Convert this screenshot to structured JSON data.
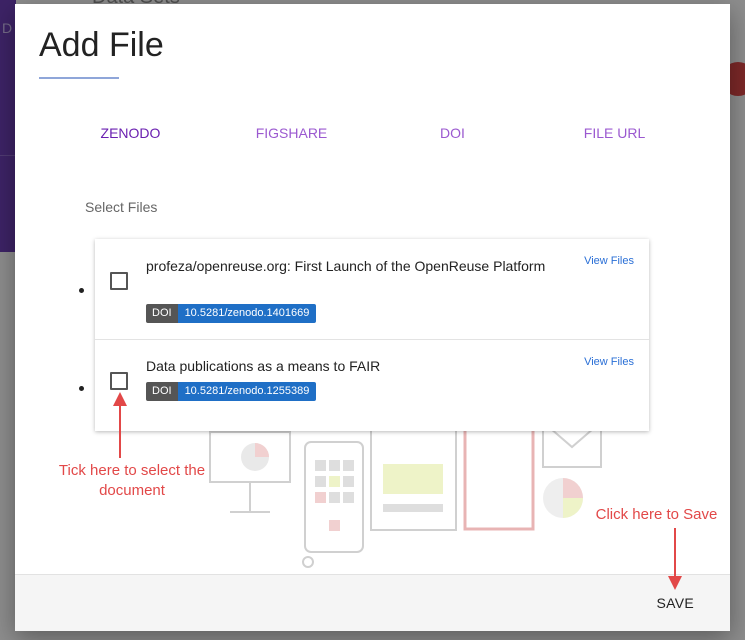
{
  "background": {
    "fragment_letter": "D",
    "fragment_title": "Data Sets"
  },
  "dialog": {
    "title": "Add File",
    "tabs": [
      {
        "label": "ZENODO",
        "active": true
      },
      {
        "label": "FIGSHARE",
        "active": false
      },
      {
        "label": "DOI",
        "active": false
      },
      {
        "label": "FILE URL",
        "active": false
      }
    ],
    "select_label": "Select Files",
    "files": [
      {
        "title": "profeza/openreuse.org: First Launch of the OpenReuse Platform",
        "doi_key": "DOI",
        "doi": "10.5281/zenodo.1401669",
        "view_label": "View Files",
        "checked": false
      },
      {
        "title": "Data publications as a means to FAIR",
        "doi_key": "DOI",
        "doi": "10.5281/zenodo.1255389",
        "view_label": "View Files",
        "checked": false
      }
    ],
    "save_label": "SAVE"
  },
  "annotations": {
    "tick_hint": "Tick here to select the document",
    "save_hint": "Click here to Save"
  },
  "colors": {
    "tab_active": "#6a1fb0",
    "tab_inactive": "#9b59d0",
    "doi_badge": "#1f6fc6",
    "annotation": "#e24848"
  }
}
